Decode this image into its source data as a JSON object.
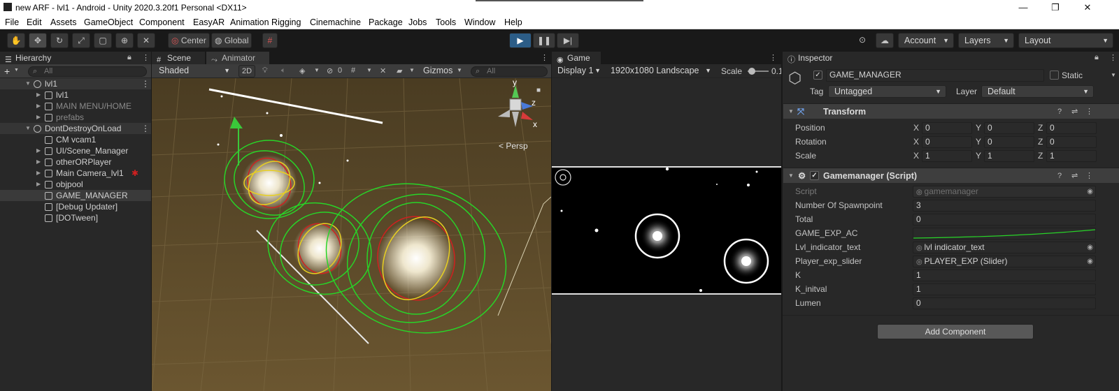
{
  "window": {
    "title": "new ARF - lvl1 - Android - Unity 2020.3.20f1 Personal <DX11>",
    "minimize": "—",
    "maximize": "❐",
    "close": "✕"
  },
  "menu": [
    "File",
    "Edit",
    "Assets",
    "GameObject",
    "Component",
    "EasyAR",
    "Animation Rigging",
    "Cinemachine",
    "Package",
    "Jobs",
    "Tools",
    "Window",
    "Help"
  ],
  "toolbar": {
    "pivot": "Center",
    "space": "Global",
    "account": "Account",
    "layers": "Layers",
    "layout": "Layout"
  },
  "hierarchy": {
    "tab": "Hierarchy",
    "search_placeholder": "All",
    "rows": [
      {
        "label": "lvl1",
        "scene": true
      },
      {
        "label": "lvl1"
      },
      {
        "label": "MAIN MENU/HOME",
        "dim": true
      },
      {
        "label": "prefabs",
        "dim": true
      },
      {
        "label": "DontDestroyOnLoad",
        "scene": true
      },
      {
        "label": "CM vcam1"
      },
      {
        "label": "UI/Scene_Manager"
      },
      {
        "label": "otherORPlayer"
      },
      {
        "label": "Main Camera_lvl1"
      },
      {
        "label": "objpool"
      },
      {
        "label": "GAME_MANAGER",
        "selected": true
      },
      {
        "label": "[Debug Updater]"
      },
      {
        "label": "[DOTween]"
      }
    ]
  },
  "scene": {
    "tabs": [
      "Scene",
      "Animator"
    ],
    "shading": "Shaded",
    "mode2d": "2D",
    "hidden_count": "0",
    "gizmos": "Gizmos",
    "search_placeholder": "All",
    "persp": "< Persp",
    "axis_y": "y",
    "axis_z": "z",
    "axis_x": "x"
  },
  "game": {
    "tab": "Game",
    "display": "Display 1",
    "resolution": "1920x1080 Landscape",
    "scale_label": "Scale",
    "scale_value": "0.1"
  },
  "inspector": {
    "tab": "Inspector",
    "object_name": "GAME_MANAGER",
    "static": "Static",
    "tag_label": "Tag",
    "tag": "Untagged",
    "layer_label": "Layer",
    "layer": "Default",
    "transform": {
      "title": "Transform",
      "rows": [
        {
          "label": "Position",
          "x": "0",
          "y": "0",
          "z": "0"
        },
        {
          "label": "Rotation",
          "x": "0",
          "y": "0",
          "z": "0"
        },
        {
          "label": "Scale",
          "x": "1",
          "y": "1",
          "z": "1"
        }
      ]
    },
    "script": {
      "title": "Gamemanager (Script)",
      "rows": [
        {
          "label": "Script",
          "value": "gamemanager",
          "kind": "ref-dim"
        },
        {
          "label": "Number Of Spawnpoint",
          "value": "3"
        },
        {
          "label": "Total",
          "value": "0"
        },
        {
          "label": "GAME_EXP_AC",
          "value": "",
          "kind": "curve"
        },
        {
          "label": "Lvl_indicator_text",
          "value": "lvl indicator_text",
          "kind": "ref"
        },
        {
          "label": "Player_exp_slider",
          "value": "PLAYER_EXP (Slider)",
          "kind": "ref"
        },
        {
          "label": "K",
          "value": "1"
        },
        {
          "label": "K_initval",
          "value": "1"
        },
        {
          "label": "Lumen",
          "value": "0"
        }
      ]
    },
    "add_component": "Add Component"
  },
  "colors": {
    "accent": "#2c5d87",
    "gizmo_green": "#28d428",
    "gizmo_red": "#d02020",
    "gizmo_yellow": "#e8d020",
    "scene_bg": "#5a4a28"
  }
}
